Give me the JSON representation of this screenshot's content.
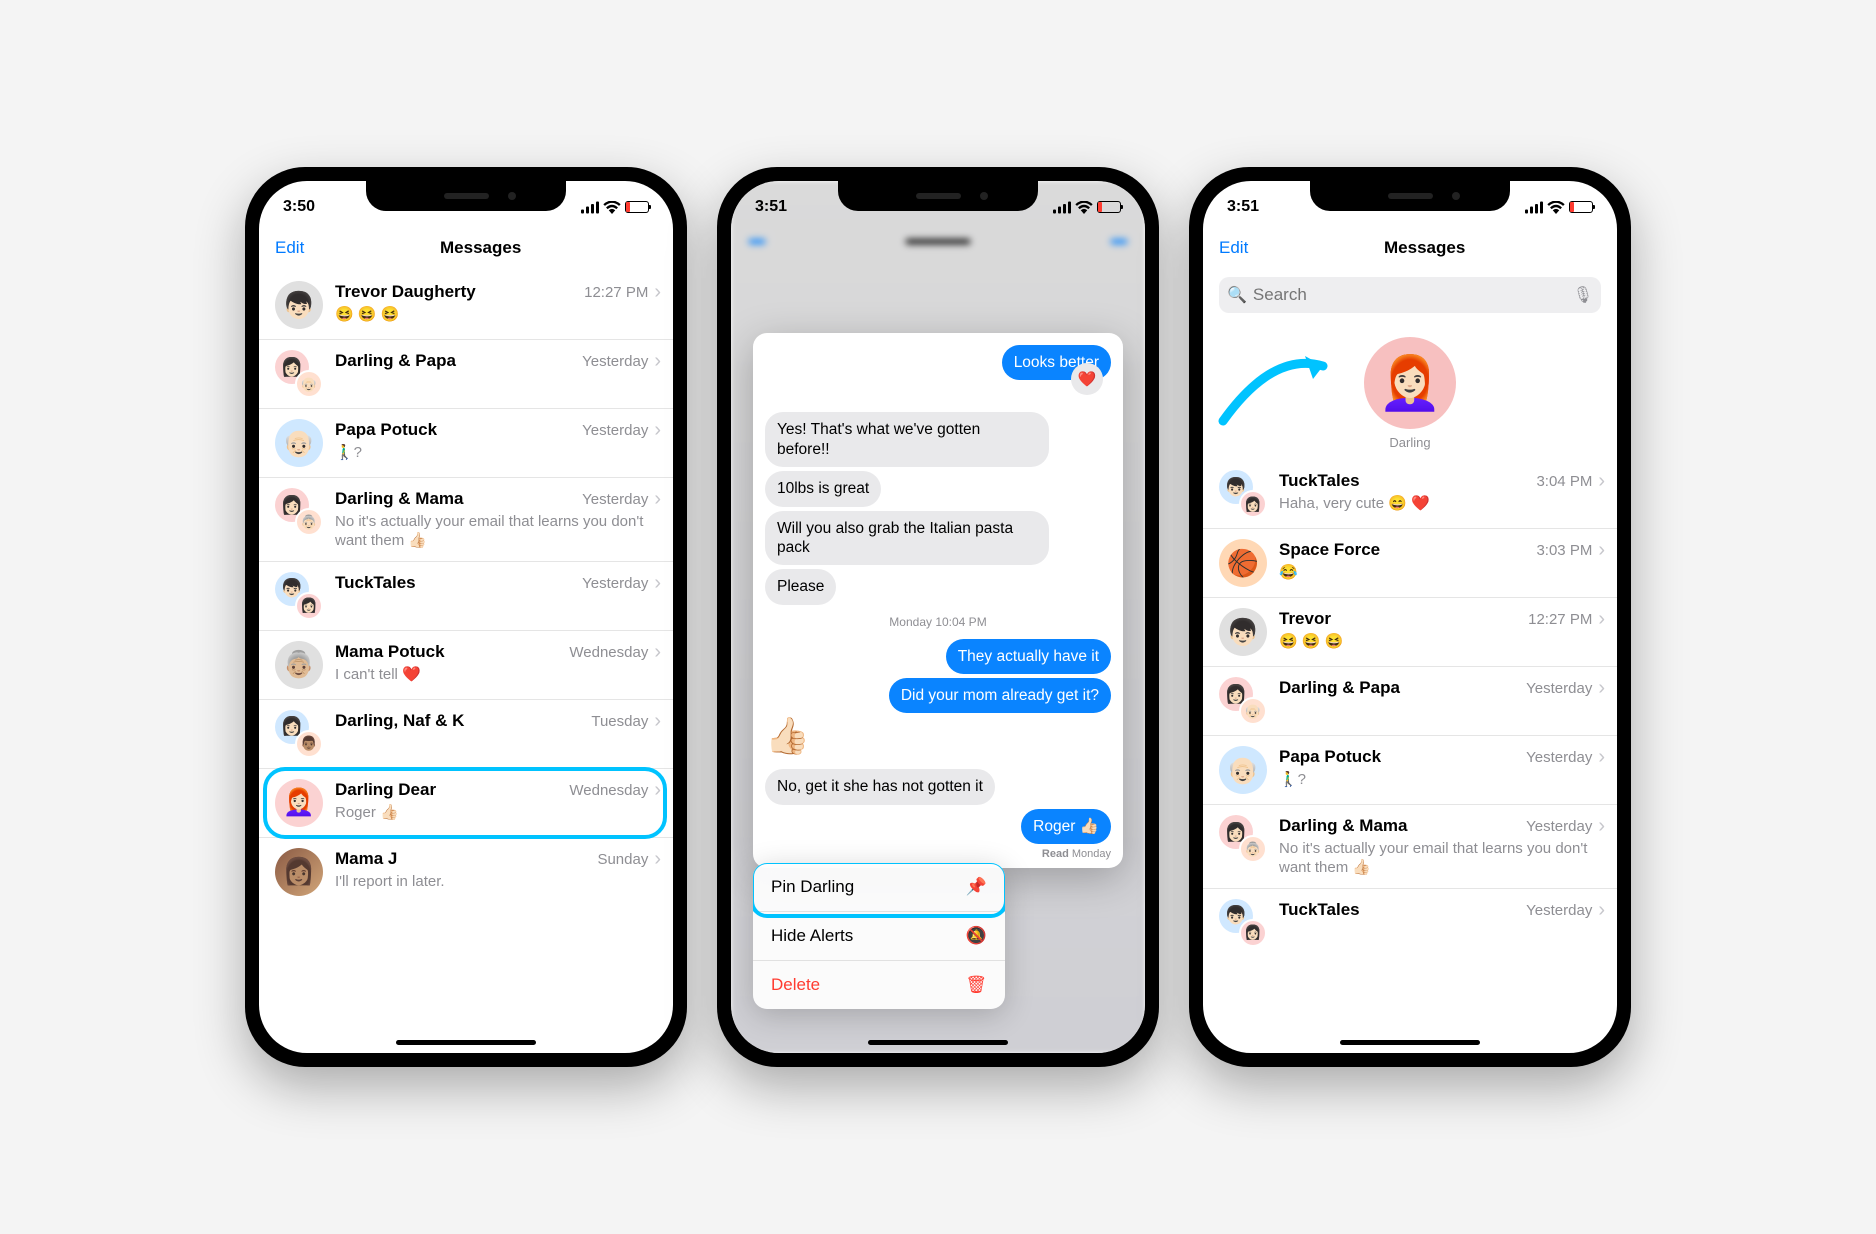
{
  "phone1": {
    "time": "3:50",
    "edit": "Edit",
    "title": "Messages",
    "rows": [
      {
        "name": "Trevor Daugherty",
        "time": "12:27 PM",
        "preview": "😆 😆 😆"
      },
      {
        "name": "Darling & Papa",
        "time": "Yesterday",
        "preview": ""
      },
      {
        "name": "Papa Potuck",
        "time": "Yesterday",
        "preview": "🚶‍♂️?"
      },
      {
        "name": "Darling & Mama",
        "time": "Yesterday",
        "preview": "No it's actually your email that learns you don't want them 👍🏻"
      },
      {
        "name": "TuckTales",
        "time": "Yesterday",
        "preview": ""
      },
      {
        "name": "Mama Potuck",
        "time": "Wednesday",
        "preview": "I can't tell ❤️"
      },
      {
        "name": "Darling, Naf & K",
        "time": "Tuesday",
        "preview": ""
      },
      {
        "name": "Darling Dear",
        "time": "Wednesday",
        "preview": "Roger 👍🏻"
      },
      {
        "name": "Mama J",
        "time": "Sunday",
        "preview": "I'll report in later."
      }
    ]
  },
  "phone2": {
    "time": "3:51",
    "messages": {
      "sent0": "Looks better",
      "recv1": "Yes! That's what we've gotten before!!",
      "recv2": "10lbs is great",
      "recv3": "Will you also grab the Italian pasta pack",
      "recv4": "Please",
      "ts": "Monday 10:04 PM",
      "sent1": "They actually have it",
      "sent2": "Did your mom already get it?",
      "thumb": "👍🏻",
      "recv5": "No, get it she has not gotten it",
      "sent3": "Roger 👍🏻",
      "read": "Read Monday"
    },
    "ctx": {
      "pin": "Pin Darling",
      "hide": "Hide Alerts",
      "delete": "Delete"
    }
  },
  "phone3": {
    "time": "3:51",
    "edit": "Edit",
    "title": "Messages",
    "search_placeholder": "Search",
    "pinned": {
      "name": "Darling"
    },
    "rows": [
      {
        "name": "TuckTales",
        "time": "3:04 PM",
        "preview": "Haha, very cute 😄 ❤️"
      },
      {
        "name": "Space Force",
        "time": "3:03 PM",
        "preview": "😂"
      },
      {
        "name": "Trevor",
        "time": "12:27 PM",
        "preview": "😆 😆 😆"
      },
      {
        "name": "Darling & Papa",
        "time": "Yesterday",
        "preview": ""
      },
      {
        "name": "Papa Potuck",
        "time": "Yesterday",
        "preview": "🚶‍♂️?"
      },
      {
        "name": "Darling & Mama",
        "time": "Yesterday",
        "preview": "No it's actually your email that learns you don't want them 👍🏻"
      },
      {
        "name": "TuckTales",
        "time": "Yesterday",
        "preview": ""
      }
    ]
  }
}
